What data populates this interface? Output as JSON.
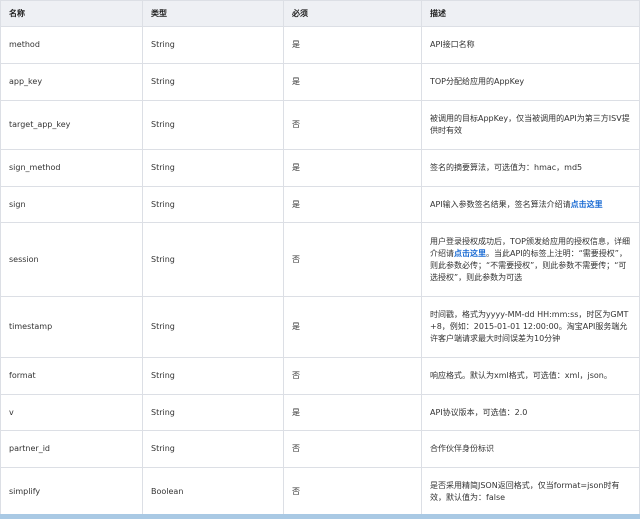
{
  "headers": {
    "name": "名称",
    "type": "类型",
    "required": "必须",
    "desc": "描述"
  },
  "rows": [
    {
      "name": "method",
      "type": "String",
      "required": "是",
      "desc": "API接口名称"
    },
    {
      "name": "app_key",
      "type": "String",
      "required": "是",
      "desc": "TOP分配给应用的AppKey"
    },
    {
      "name": "target_app_key",
      "type": "String",
      "required": "否",
      "desc": "被调用的目标AppKey，仅当被调用的API为第三方ISV提供时有效"
    },
    {
      "name": "sign_method",
      "type": "String",
      "required": "是",
      "desc": "签名的摘要算法，可选值为：hmac，md5"
    },
    {
      "name": "sign",
      "type": "String",
      "required": "是",
      "desc_pre": "API输入参数签名结果，签名算法介绍请",
      "desc_link": "点击这里"
    },
    {
      "name": "session",
      "type": "String",
      "required": "否",
      "desc_pre": "用户登录授权成功后，TOP颁发给应用的授权信息，详细介绍请",
      "desc_link": "点击这里",
      "desc_post": "。当此API的标签上注明：“需要授权”，则此参数必传；“不需要授权”，则此参数不需要传；“可选授权”，则此参数为可选"
    },
    {
      "name": "timestamp",
      "type": "String",
      "required": "是",
      "desc": "时间戳，格式为yyyy-MM-dd HH:mm:ss，时区为GMT+8，例如：2015-01-01 12:00:00。淘宝API服务端允许客户端请求最大时间误差为10分钟"
    },
    {
      "name": "format",
      "type": "String",
      "required": "否",
      "desc": "响应格式。默认为xml格式，可选值：xml，json。"
    },
    {
      "name": "v",
      "type": "String",
      "required": "是",
      "desc": "API协议版本，可选值：2.0"
    },
    {
      "name": "partner_id",
      "type": "String",
      "required": "否",
      "desc": "合作伙伴身份标识"
    },
    {
      "name": "simplify",
      "type": "Boolean",
      "required": "否",
      "desc": "是否采用精简JSON返回格式，仅当format=json时有效，默认值为：false"
    }
  ]
}
